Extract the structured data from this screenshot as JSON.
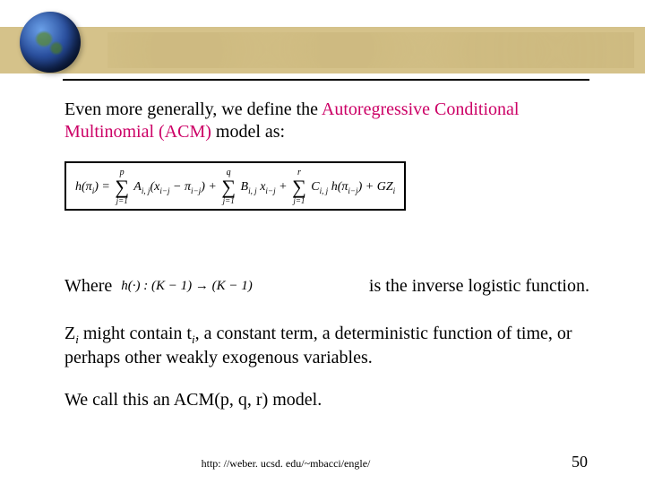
{
  "intro": {
    "pre": "Even more generally, we define the ",
    "term": "Autoregressive Conditional Multinomial (ACM)",
    "post": " model as:"
  },
  "equation": {
    "lhs": "h(π_i) =",
    "sum1": {
      "top": "p",
      "bot": "j=1",
      "term": "A_{i,j}(x_{i−j} − π_{i−j})"
    },
    "plus1": "+",
    "sum2": {
      "top": "q",
      "bot": "j=1",
      "term": "B_{i,j} x_{i−j}"
    },
    "plus2": "+",
    "sum3": {
      "top": "r",
      "bot": "j=1",
      "term": "C_{i,j} h(π_{i−j})"
    },
    "tail": "+ G Z_i"
  },
  "where": {
    "label": "Where",
    "map": "h(·) : (K − 1) → (K − 1)",
    "desc": "is the inverse logistic function."
  },
  "z_para": {
    "pre": "Z",
    "sub1": "i",
    "mid": " might contain t",
    "sub2": "i",
    "post": ", a constant term, a deterministic function of time, or perhaps other weakly exogenous variables."
  },
  "call": "We call this an ACM(p, q, r) model.",
  "footer": {
    "url": "http: //weber. ucsd. edu/~mbacci/engle/",
    "page": "50"
  }
}
